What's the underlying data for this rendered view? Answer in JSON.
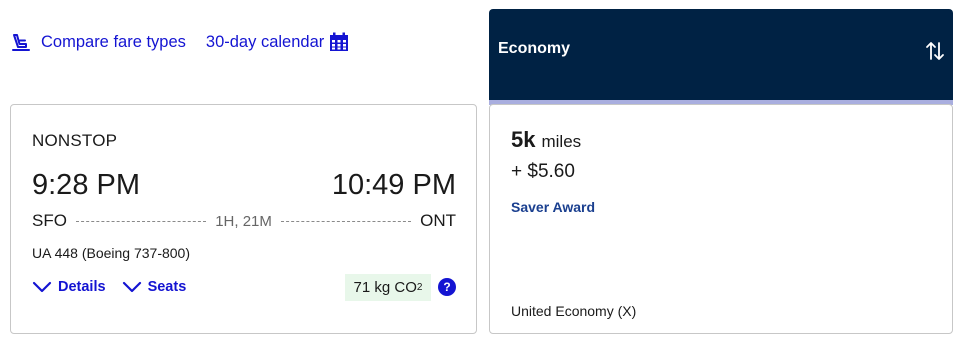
{
  "links": {
    "compare_fare_types": "Compare fare types",
    "calendar": "30-day calendar"
  },
  "flight": {
    "stop_type": "NONSTOP",
    "depart_time": "9:28 PM",
    "arrive_time": "10:49 PM",
    "origin": "SFO",
    "destination": "ONT",
    "duration": "1H, 21M",
    "flight_info": "UA 448 (Boeing 737-800)",
    "details_label": "Details",
    "seats_label": "Seats",
    "co2_value": "71 kg CO",
    "co2_subscript": "2",
    "help_label": "?"
  },
  "fare": {
    "column_title": "Economy",
    "miles_amount": "5k",
    "miles_unit": "miles",
    "taxes": "+ $5.60",
    "award_type": "Saver Award",
    "cabin": "United Economy (X)"
  },
  "colors": {
    "link_blue": "#1414d2",
    "header_navy": "#002244",
    "header_accent": "#a9aedf",
    "co2_bg": "#e8f7ea",
    "award_blue": "#1a3f8f"
  },
  "icons": {
    "compare": "seat-icon",
    "calendar": "calendar-icon",
    "sort": "sort-arrows-icon",
    "expand": "chevron-down-icon"
  }
}
